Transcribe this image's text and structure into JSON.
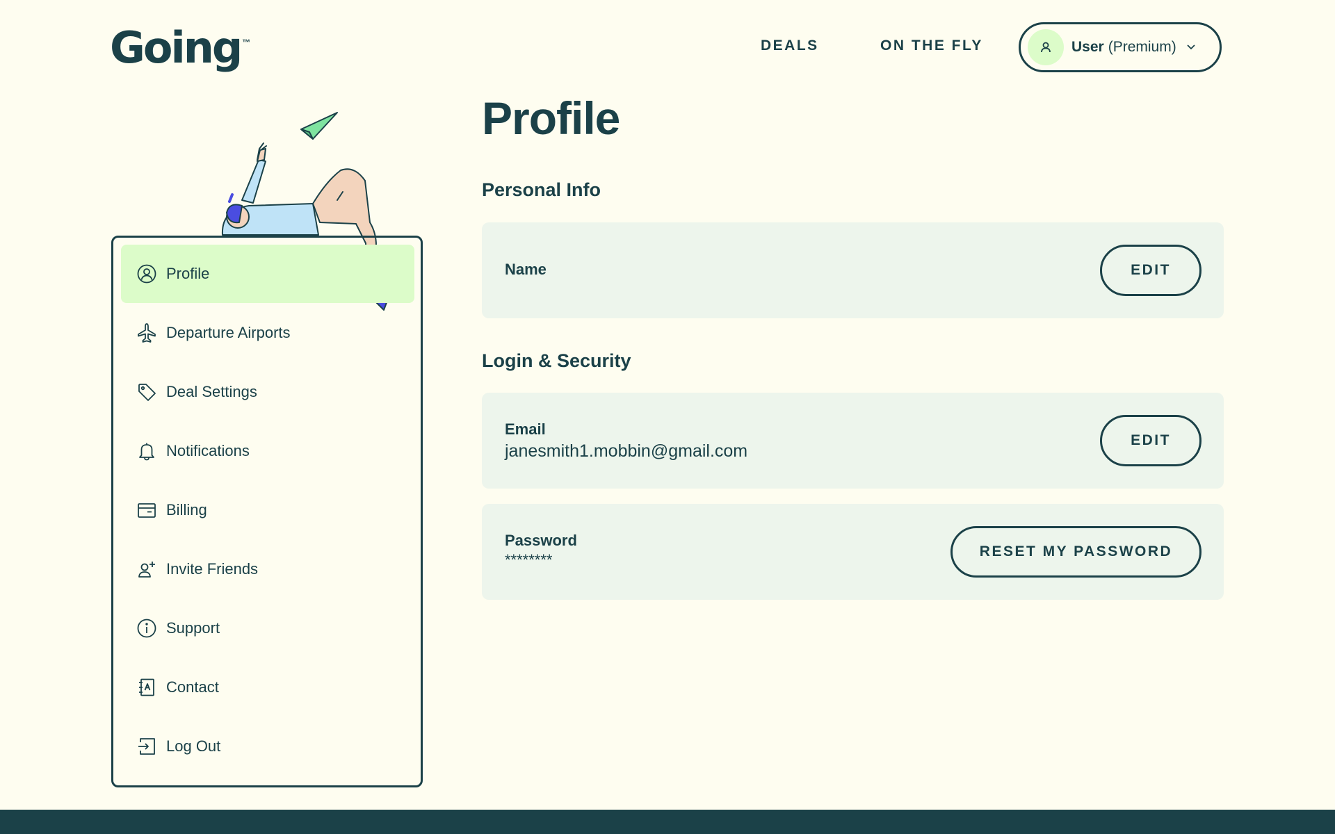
{
  "brand": {
    "name": "Going",
    "tm": "™"
  },
  "nav": {
    "deals": "DEALS",
    "on_the_fly": "ON THE FLY",
    "user_name": "User",
    "user_tier": "(Premium)"
  },
  "sidebar": {
    "items": [
      {
        "label": "Profile",
        "icon": "user-circle-icon",
        "active": true
      },
      {
        "label": "Departure Airports",
        "icon": "plane-icon"
      },
      {
        "label": "Deal Settings",
        "icon": "tag-icon"
      },
      {
        "label": "Notifications",
        "icon": "bell-icon"
      },
      {
        "label": "Billing",
        "icon": "wallet-icon"
      },
      {
        "label": "Invite Friends",
        "icon": "user-plus-icon"
      },
      {
        "label": "Support",
        "icon": "info-icon"
      },
      {
        "label": "Contact",
        "icon": "address-book-icon"
      },
      {
        "label": "Log Out",
        "icon": "logout-icon"
      }
    ]
  },
  "main": {
    "title": "Profile",
    "personal_info": {
      "heading": "Personal Info",
      "name_label": "Name",
      "edit_label": "EDIT"
    },
    "login_security": {
      "heading": "Login & Security",
      "email_label": "Email",
      "email_value": "janesmith1.mobbin@gmail.com",
      "edit_label": "EDIT",
      "password_label": "Password",
      "password_value": "********",
      "reset_label": "RESET MY PASSWORD"
    }
  },
  "colors": {
    "background": "#fefdf0",
    "primary": "#1b4148",
    "active_highlight": "#dcfcc9",
    "card": "#edf5ec"
  }
}
